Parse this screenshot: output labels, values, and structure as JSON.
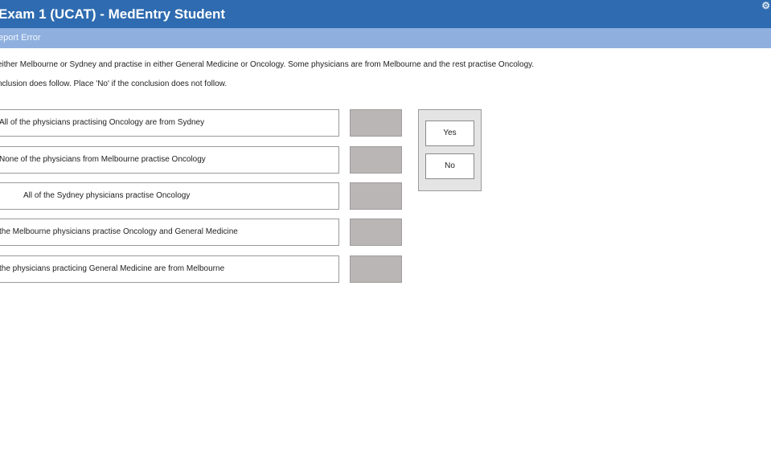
{
  "window": {
    "title": "Exam 1 (UCAT) - MedEntry Student",
    "settings_icon": "gear-icon"
  },
  "toolbar": {
    "report_error_label": "eport Error"
  },
  "question": {
    "stem": "either Melbourne or Sydney and practise in either General Medicine or Oncology. Some physicians are from Melbourne and the rest practise Oncology.",
    "instruction": "nclusion does follow. Place 'No' if the conclusion does not follow."
  },
  "statements": [
    "All of the physicians practising Oncology are from Sydney",
    "None of the physicians from Melbourne practise Oncology",
    "All of the Sydney physicians practise Oncology",
    "the Melbourne physicians practise Oncology and General Medicine",
    "the physicians practicing General Medicine are from Melbourne"
  ],
  "answers": {
    "yes_label": "Yes",
    "no_label": "No"
  }
}
